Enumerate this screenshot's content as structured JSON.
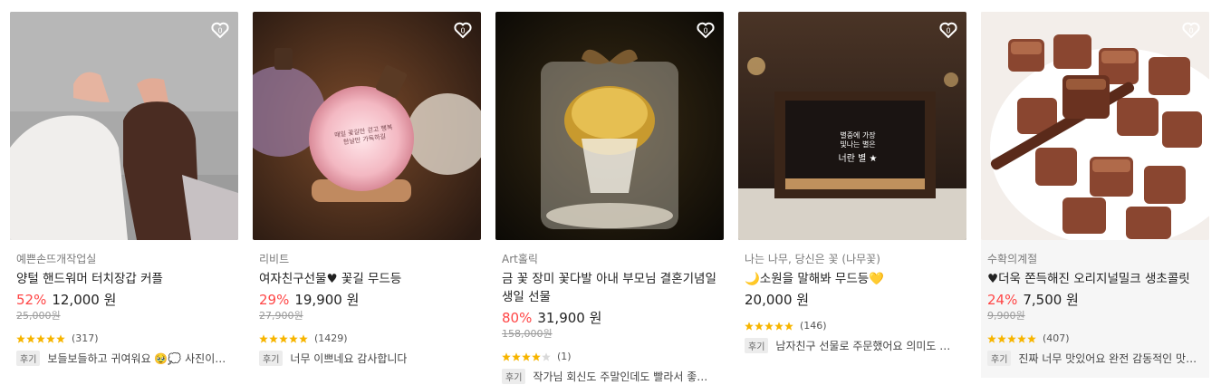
{
  "products": [
    {
      "seller": "예쁜손뜨개작업실",
      "title": "양털 핸드워머 터치장갑 커플",
      "discount": "52%",
      "price": "12,000 원",
      "original_price": "25,000원",
      "rating": 5,
      "review_count": "(317)",
      "review_tag": "후기",
      "review": "보들보들하고 귀여워요 🥹💭 사진이랑 같..."
    },
    {
      "seller": "리비트",
      "title": "여자친구선물♥ 꽃길 무드등",
      "discount": "29%",
      "price": "19,900 원",
      "original_price": "27,900원",
      "rating": 5,
      "review_count": "(1429)",
      "review_tag": "후기",
      "review": "너무 이쁘네요 감사합니다",
      "overlay_text": "매일 꽃길만 걷고 행복한날만 가득하길"
    },
    {
      "seller": "Art홀릭",
      "title": "금 꽃 장미 꽃다발 아내 부모님 결혼기념일 생일 선물",
      "discount": "80%",
      "price": "31,900 원",
      "original_price": "158,000원",
      "rating": 4,
      "review_count": "(1)",
      "review_tag": "후기",
      "review": "작가님 회신도 주말인데도 빨라서 좋았구 몰..."
    },
    {
      "seller": "나는 나무, 당신은 꽃 (나무꽃)",
      "title": "🌙소원을 말해봐 무드등💛",
      "discount": "",
      "price": "20,000 원",
      "original_price": "",
      "rating": 5,
      "review_count": "(146)",
      "review_tag": "후기",
      "review": "남자친구 선물로 주문했어요 의미도 있고 무...",
      "overlay_line1": "별중에 가장",
      "overlay_line2": "빛나는 별은",
      "overlay_line3": "너란 별 ★"
    },
    {
      "seller": "수확의계절",
      "title": "♥더욱 쫀득해진 오리지널밀크 생초콜릿",
      "discount": "24%",
      "price": "7,500 원",
      "original_price": "9,900원",
      "rating": 5,
      "review_count": "(407)",
      "review_tag": "후기",
      "review": "진짜 너무 맛있어요 완전 감동적인 맛이에요 ..."
    }
  ],
  "colors": {
    "discount": "#ff4646",
    "star": "#f7b500",
    "star_empty": "#d9d9d9"
  }
}
